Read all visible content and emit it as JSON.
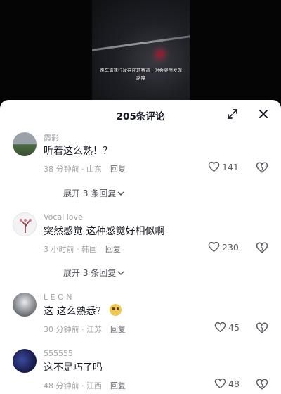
{
  "video": {
    "caption": "跑车满速行驶在闭环赛道上时会突然发现路障"
  },
  "sheet": {
    "title": "205条评论"
  },
  "comments": [
    {
      "username": "霞影",
      "text": "听着这么熟！？",
      "time": "38 分钟前",
      "location": "山东",
      "reply": "回复",
      "likes": "141",
      "expand": "展开 3 条回复"
    },
    {
      "username": "Vocal love",
      "text": "突然感觉 这种感觉好相似啊",
      "time": "3 小时前",
      "location": "韩国",
      "reply": "回复",
      "likes": "230",
      "expand": "展开 3 条回复"
    },
    {
      "username": "L E O N",
      "text": "这  这么熟悉？",
      "time": "30 分钟前",
      "location": "江苏",
      "reply": "回复",
      "likes": "45",
      "emoji": "awkward-smile-emoji"
    },
    {
      "username": "555555",
      "text": "这不是巧了吗",
      "time": "48 分钟前",
      "location": "江西",
      "reply": "回复",
      "likes": "48"
    }
  ]
}
